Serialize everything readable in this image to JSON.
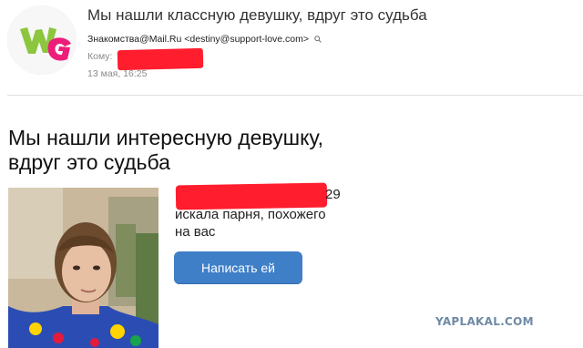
{
  "email": {
    "subject": "Мы нашли классную девушку, вдруг это судьба",
    "from": "Знакомства@Mail.Ru <destiny@support-love.com>",
    "to_label": "Кому:",
    "date": "13 мая, 16:25"
  },
  "body": {
    "headline": "Мы нашли интересную девушку, вдруг это судьба",
    "age": "29",
    "description": "искала парня, похожего на вас",
    "write_button": "Написать ей"
  },
  "watermark": "YAPLAKAL.COM",
  "colors": {
    "accent_button": "#3f7fc8",
    "redaction": "#ff1d2e",
    "logo_green": "#8cc63f",
    "logo_pink": "#ec1e79"
  },
  "icons": [
    "sender-logo",
    "search-icon"
  ]
}
